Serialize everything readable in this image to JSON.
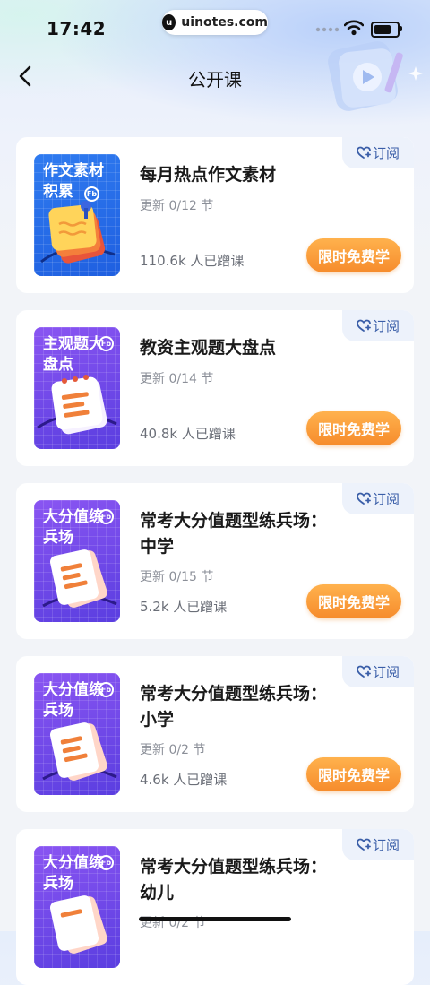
{
  "status_bar": {
    "time": "17:42",
    "watermark": "uinotes.com",
    "watermark_logo": "u"
  },
  "header": {
    "title": "公开课",
    "back_icon": "chevron-left-icon"
  },
  "subscribe_label": "订阅",
  "free_label": "限时免费学",
  "courses": [
    {
      "cover_text": "作文素材积累",
      "cover_badge": "Fb",
      "cover_color": "#2f7bf0",
      "cover_art": "notes-stack-icon",
      "title": "每月热点作文素材",
      "update": "更新 0/12 节",
      "students": "110.6k 人已蹭课"
    },
    {
      "cover_text": "主观题大盘点",
      "cover_badge": "Fb",
      "cover_color": "#8a55f2",
      "cover_art": "notepad-icon",
      "title": "教资主观题大盘点",
      "update": "更新 0/14 节",
      "students": "40.8k 人已蹭课"
    },
    {
      "cover_text": "大分值练兵场",
      "cover_badge": "Fb",
      "cover_color": "#7b52ee",
      "cover_art": "papers-icon",
      "title": "常考大分值题型练兵场：中学",
      "update": "更新 0/15 节",
      "students": "5.2k 人已蹭课"
    },
    {
      "cover_text": "大分值练兵场",
      "cover_badge": "Fb",
      "cover_color": "#7b52ee",
      "cover_art": "papers-icon",
      "title": "常考大分值题型练兵场：小学",
      "update": "更新 0/2 节",
      "students": "4.6k 人已蹭课"
    },
    {
      "cover_text": "大分值练兵场",
      "cover_badge": "Fb",
      "cover_color": "#7b52ee",
      "cover_art": "papers-icon",
      "title": "常考大分值题型练兵场：幼儿",
      "update": "更新 0/2 节",
      "students": ""
    }
  ]
}
